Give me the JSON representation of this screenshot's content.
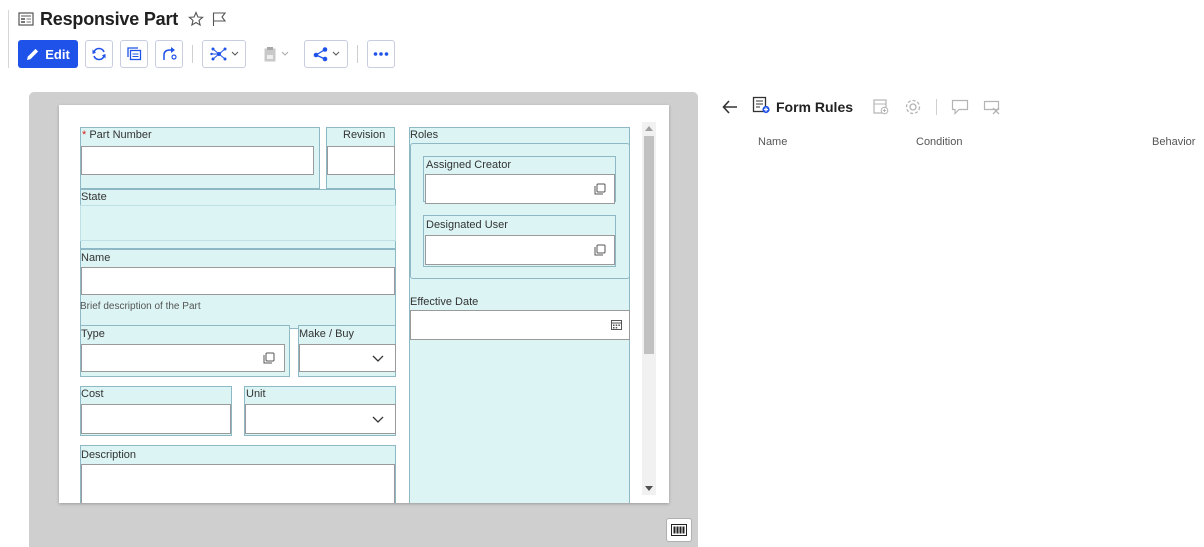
{
  "header": {
    "title": "Responsive Part",
    "edit_label": "Edit"
  },
  "form": {
    "part_number_label": "Part Number",
    "required_mark": "*",
    "revision_label": "Revision",
    "state_label": "State",
    "name_label": "Name",
    "name_hint": "Brief description of the Part",
    "type_label": "Type",
    "make_buy_label": "Make / Buy",
    "cost_label": "Cost",
    "unit_label": "Unit",
    "description_label": "Description",
    "roles_label": "Roles",
    "assigned_creator_label": "Assigned Creator",
    "designated_user_label": "Designated User",
    "effective_date_label": "Effective Date"
  },
  "rules": {
    "title": "Form Rules",
    "columns": [
      "Name",
      "Condition",
      "Behavior"
    ]
  },
  "colors": {
    "accent": "#1f52e8",
    "cell_fill": "#dcf4f4",
    "cell_border": "#8eb8c4",
    "canvas": "#cfcfcf"
  },
  "icons": [
    "form-icon",
    "star-icon",
    "flag-icon",
    "pencil-icon",
    "refresh-icon",
    "copy-icon",
    "connect-icon",
    "structure-icon",
    "clipboard-icon",
    "share-icon",
    "more-icon",
    "lookup-icon",
    "calendar-icon",
    "chevron-down-icon",
    "back-arrow-icon",
    "form-rules-icon",
    "add-rule-icon",
    "settings-icon",
    "comment-icon",
    "delete-rule-icon",
    "columns-icon"
  ]
}
